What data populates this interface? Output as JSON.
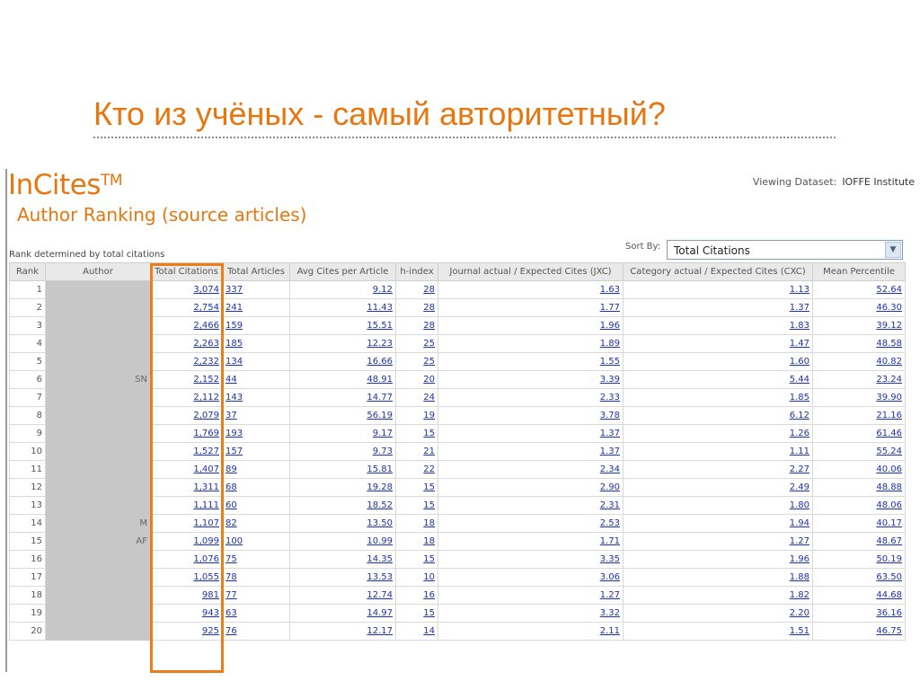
{
  "slide": {
    "title": "Кто из учёных - самый авторитетный?"
  },
  "app": {
    "logo": "InCites",
    "logo_tm": "TM",
    "subtitle": "Author Ranking (source articles)",
    "dataset_label": "Viewing Dataset:",
    "dataset_value": "IOFFE Institute",
    "rank_note": "Rank determined by total citations",
    "sort_by_label": "Sort By:",
    "sort_by_value": "Total Citations",
    "colors": {
      "accent": "#e8760e",
      "link": "#1b32b0",
      "highlight": "#ed7d15"
    }
  },
  "table": {
    "columns": [
      "Rank",
      "Author",
      "Total Citations",
      "Total Articles",
      "Avg Cites per Article",
      "h-index",
      "Journal actual / Expected Cites (JXC)",
      "Category actual / Expected Cites (CXC)",
      "Mean Percentile"
    ],
    "rows": [
      {
        "rank": "1",
        "author": "",
        "total_citations": "3,074",
        "total_articles": "337",
        "avg_cites": "9.12",
        "h_index": "28",
        "jxc": "1.63",
        "cxc": "1.13",
        "mean_percentile": "52.64"
      },
      {
        "rank": "2",
        "author": "",
        "total_citations": "2,754",
        "total_articles": "241",
        "avg_cites": "11.43",
        "h_index": "28",
        "jxc": "1.77",
        "cxc": "1.37",
        "mean_percentile": "46.30"
      },
      {
        "rank": "3",
        "author": "",
        "total_citations": "2,466",
        "total_articles": "159",
        "avg_cites": "15.51",
        "h_index": "28",
        "jxc": "1.96",
        "cxc": "1.83",
        "mean_percentile": "39.12"
      },
      {
        "rank": "4",
        "author": "",
        "total_citations": "2,263",
        "total_articles": "185",
        "avg_cites": "12.23",
        "h_index": "25",
        "jxc": "1.89",
        "cxc": "1.47",
        "mean_percentile": "48.58"
      },
      {
        "rank": "5",
        "author": "",
        "total_citations": "2,232",
        "total_articles": "134",
        "avg_cites": "16.66",
        "h_index": "25",
        "jxc": "1.55",
        "cxc": "1.60",
        "mean_percentile": "40.82"
      },
      {
        "rank": "6",
        "author": "SN",
        "total_citations": "2,152",
        "total_articles": "44",
        "avg_cites": "48.91",
        "h_index": "20",
        "jxc": "3.39",
        "cxc": "5.44",
        "mean_percentile": "23.24"
      },
      {
        "rank": "7",
        "author": "",
        "total_citations": "2,112",
        "total_articles": "143",
        "avg_cites": "14.77",
        "h_index": "24",
        "jxc": "2.33",
        "cxc": "1.85",
        "mean_percentile": "39.90"
      },
      {
        "rank": "8",
        "author": "",
        "total_citations": "2,079",
        "total_articles": "37",
        "avg_cites": "56.19",
        "h_index": "19",
        "jxc": "3.78",
        "cxc": "6.12",
        "mean_percentile": "21.16"
      },
      {
        "rank": "9",
        "author": "",
        "total_citations": "1,769",
        "total_articles": "193",
        "avg_cites": "9.17",
        "h_index": "15",
        "jxc": "1.37",
        "cxc": "1.26",
        "mean_percentile": "61.46"
      },
      {
        "rank": "10",
        "author": "",
        "total_citations": "1,527",
        "total_articles": "157",
        "avg_cites": "9.73",
        "h_index": "21",
        "jxc": "1.37",
        "cxc": "1.11",
        "mean_percentile": "55.24"
      },
      {
        "rank": "11",
        "author": "",
        "total_citations": "1,407",
        "total_articles": "89",
        "avg_cites": "15.81",
        "h_index": "22",
        "jxc": "2.34",
        "cxc": "2.27",
        "mean_percentile": "40.06"
      },
      {
        "rank": "12",
        "author": "",
        "total_citations": "1,311",
        "total_articles": "68",
        "avg_cites": "19.28",
        "h_index": "15",
        "jxc": "2.90",
        "cxc": "2.49",
        "mean_percentile": "48.88"
      },
      {
        "rank": "13",
        "author": "",
        "total_citations": "1,111",
        "total_articles": "60",
        "avg_cites": "18.52",
        "h_index": "15",
        "jxc": "2.31",
        "cxc": "1.80",
        "mean_percentile": "48.06"
      },
      {
        "rank": "14",
        "author": "M",
        "total_citations": "1,107",
        "total_articles": "82",
        "avg_cites": "13.50",
        "h_index": "18",
        "jxc": "2.53",
        "cxc": "1.94",
        "mean_percentile": "40.17"
      },
      {
        "rank": "15",
        "author": "AF",
        "total_citations": "1,099",
        "total_articles": "100",
        "avg_cites": "10.99",
        "h_index": "18",
        "jxc": "1.71",
        "cxc": "1.27",
        "mean_percentile": "48.67"
      },
      {
        "rank": "16",
        "author": "",
        "total_citations": "1,076",
        "total_articles": "75",
        "avg_cites": "14.35",
        "h_index": "15",
        "jxc": "3.35",
        "cxc": "1.96",
        "mean_percentile": "50.19"
      },
      {
        "rank": "17",
        "author": "",
        "total_citations": "1,055",
        "total_articles": "78",
        "avg_cites": "13.53",
        "h_index": "10",
        "jxc": "3.06",
        "cxc": "1.88",
        "mean_percentile": "63.50"
      },
      {
        "rank": "18",
        "author": "",
        "total_citations": "981",
        "total_articles": "77",
        "avg_cites": "12.74",
        "h_index": "16",
        "jxc": "1.27",
        "cxc": "1.82",
        "mean_percentile": "44.68"
      },
      {
        "rank": "19",
        "author": "",
        "total_citations": "943",
        "total_articles": "63",
        "avg_cites": "14.97",
        "h_index": "15",
        "jxc": "3.32",
        "cxc": "2.20",
        "mean_percentile": "36.16"
      },
      {
        "rank": "20",
        "author": "",
        "total_citations": "925",
        "total_articles": "76",
        "avg_cites": "12.17",
        "h_index": "14",
        "jxc": "2.11",
        "cxc": "1.51",
        "mean_percentile": "46.75"
      }
    ]
  }
}
